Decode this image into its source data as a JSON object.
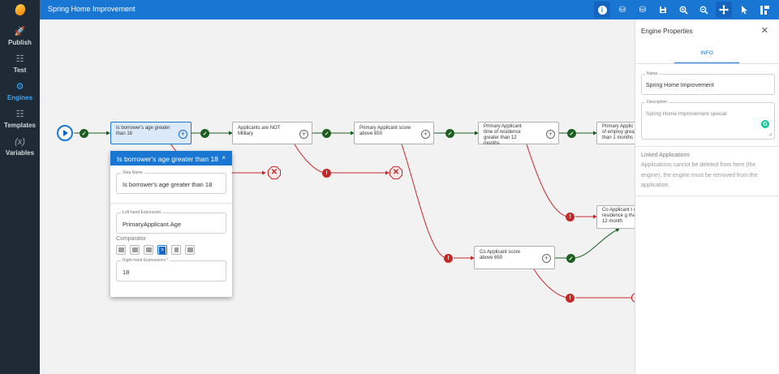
{
  "app": {
    "title": "Spring Home Improvement"
  },
  "sidebar": {
    "items": [
      {
        "id": "publish",
        "label": "Publish",
        "icon": "rocket-icon",
        "glyph": "🚀",
        "active": false
      },
      {
        "id": "test",
        "label": "Test",
        "icon": "test-icon",
        "glyph": "☷",
        "active": false
      },
      {
        "id": "engines",
        "label": "Engines",
        "icon": "engine-icon",
        "glyph": "⚙",
        "active": true
      },
      {
        "id": "templates",
        "label": "Templates",
        "icon": "template-icon",
        "glyph": "☷",
        "active": false
      },
      {
        "id": "variables",
        "label": "Variables",
        "icon": "variable-icon",
        "glyph": "(x)",
        "active": false
      }
    ]
  },
  "toolbar": {
    "buttons": [
      {
        "name": "info-icon",
        "glyph": "i",
        "active": true
      },
      {
        "name": "database-icon",
        "glyph": "⛁"
      },
      {
        "name": "database-settings-icon",
        "glyph": "⛁"
      },
      {
        "name": "save-icon",
        "glyph": "💾"
      },
      {
        "name": "zoom-in-icon",
        "glyph": "⊕"
      },
      {
        "name": "zoom-out-icon",
        "glyph": "⊖"
      },
      {
        "name": "pan-move-icon",
        "glyph": "✛",
        "active": true
      },
      {
        "name": "pointer-icon",
        "glyph": "↖"
      },
      {
        "name": "layout-icon",
        "glyph": "▣"
      }
    ]
  },
  "flow": {
    "nodes": [
      {
        "id": "n1",
        "label": "Is borrower's age greater than 18",
        "selected": true
      },
      {
        "id": "n2",
        "label": "Applicants are NOT Military"
      },
      {
        "id": "n3",
        "label": "Primary Applicant score above 650"
      },
      {
        "id": "n4",
        "label": "Primary Applicant time of residence greater than 12 months"
      },
      {
        "id": "n5",
        "label": "Primary Applic time of employ greater than 1 months"
      },
      {
        "id": "n6",
        "label": "Co Applicant score above 650"
      },
      {
        "id": "n7",
        "label": "Co Applicant t of residence g than 12 month"
      }
    ],
    "ok_symbol": "✓",
    "err_symbol": "!",
    "stop_symbol": "✕",
    "plus_symbol": "+"
  },
  "step_popup": {
    "title": "Is borrower's age greater than 18",
    "close_symbol": "×",
    "step_name_label": "Step Name",
    "step_name_value": "Is borrower's age greater than 18",
    "lhs_label": "Left-hand Expression",
    "lhs_value": "PrimaryApplicant.Age",
    "comparator_title": "Comparator",
    "comparators": [
      {
        "name": "equals-icon",
        "glyph": "",
        "active": false
      },
      {
        "name": "not-equals-icon",
        "glyph": "",
        "active": false
      },
      {
        "name": "greater-equal-icon",
        "glyph": "",
        "active": false
      },
      {
        "name": "greater-than-icon",
        "glyph": ">",
        "active": true
      },
      {
        "name": "less-than-icon",
        "glyph": "",
        "active": false
      },
      {
        "name": "less-equal-icon",
        "glyph": "",
        "active": false
      }
    ],
    "rhs_label": "Right-hand Expressions *",
    "rhs_value": "18"
  },
  "properties": {
    "title": "Engine Properties",
    "close_symbol": "✕",
    "tab": "INFO",
    "name_label": "Name",
    "name_value": "Spring Home Improvement",
    "desc_label": "Description",
    "desc_value": "Spring Home Improvement special",
    "grammarly_glyph": "G",
    "resize_glyph": "⊿",
    "linked_title": "Linked Applications",
    "linked_text": "Applications cannot be deleted from here (the engine), the engine must be removed from the application."
  },
  "colors": {
    "primary": "#1976d2",
    "sidebar": "#1e2a36",
    "success": "#1b5e20",
    "error": "#c62828"
  }
}
